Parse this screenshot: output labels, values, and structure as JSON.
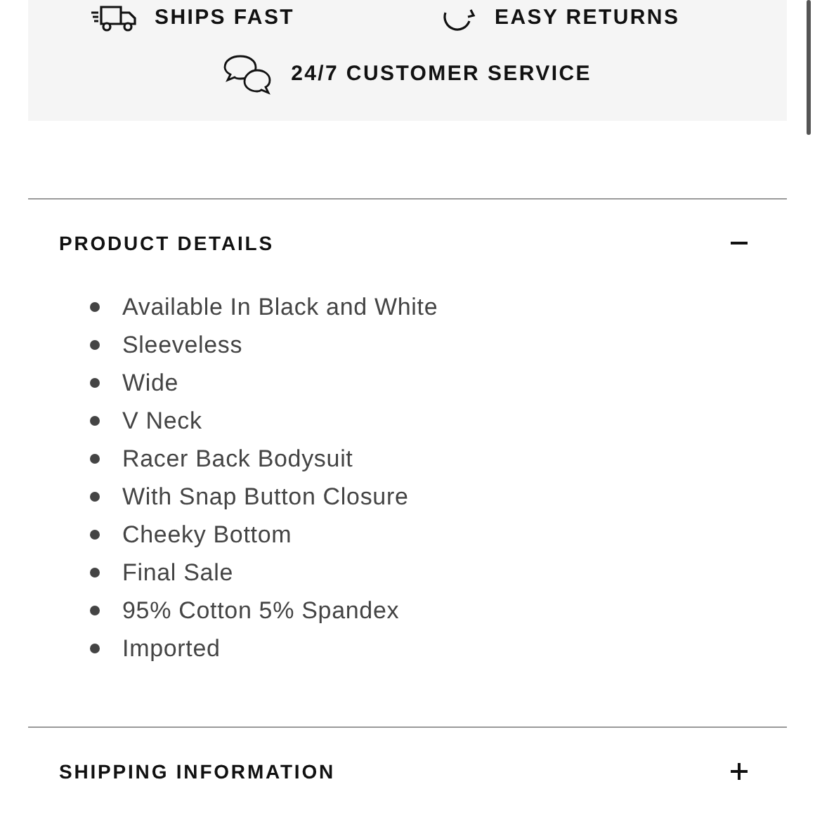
{
  "features": [
    {
      "label": "SHIPS FAST",
      "kind": "truck"
    },
    {
      "label": "EASY RETURNS",
      "kind": "returns"
    },
    {
      "label": "24/7 CUSTOMER SERVICE",
      "kind": "chat"
    }
  ],
  "sections": [
    {
      "title": "PRODUCT DETAILS",
      "expanded": true,
      "items": [
        "Available In Black and White",
        "Sleeveless",
        "Wide",
        "V Neck",
        "Racer Back Bodysuit",
        "With Snap Button Closure",
        "Cheeky Bottom",
        "Final Sale",
        "95% Cotton 5% Spandex",
        "Imported"
      ]
    },
    {
      "title": "SHIPPING INFORMATION",
      "expanded": false
    }
  ]
}
